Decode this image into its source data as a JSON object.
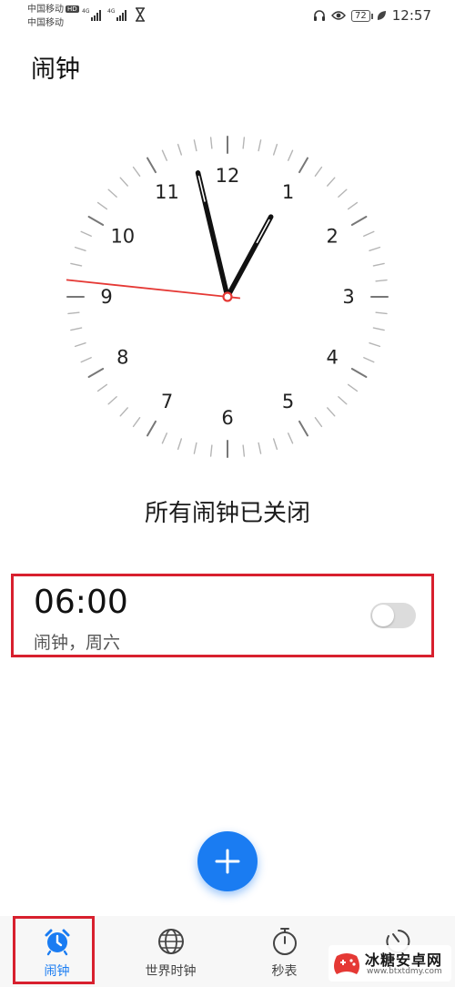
{
  "status_bar": {
    "carrier_1": "中国移动",
    "hd_badge": "HD",
    "carrier_2": "中国移动",
    "battery_level": "72",
    "time": "12:57",
    "icons": [
      "signal-icon",
      "hourglass-icon",
      "headphones-icon",
      "eye-icon",
      "battery-icon",
      "leaf-icon"
    ]
  },
  "header": {
    "title": "闹钟"
  },
  "clock": {
    "numbers": [
      "12",
      "1",
      "2",
      "3",
      "4",
      "5",
      "6",
      "7",
      "8",
      "9",
      "10",
      "11"
    ],
    "time_shown": {
      "hours": 12,
      "minutes": 57,
      "seconds": 46
    },
    "second_hand_color": "#e53935"
  },
  "status_text": "所有闹钟已关闭",
  "alarm": {
    "time": "06:00",
    "subtitle": "闹钟，周六",
    "enabled": false
  },
  "fab": {
    "icon": "plus-icon",
    "color": "#1a7cf2"
  },
  "nav": {
    "items": [
      {
        "label": "闹钟",
        "icon": "alarm-clock-icon",
        "active": true
      },
      {
        "label": "世界时钟",
        "icon": "globe-icon",
        "active": false
      },
      {
        "label": "秒表",
        "icon": "stopwatch-icon",
        "active": false
      },
      {
        "label": "",
        "icon": "timer-icon",
        "active": false
      }
    ]
  },
  "watermark": {
    "title": "冰糖安卓网",
    "url": "www.btxtdmy.com"
  },
  "colors": {
    "accent": "#1a7cf2",
    "highlight": "#d8202e"
  }
}
